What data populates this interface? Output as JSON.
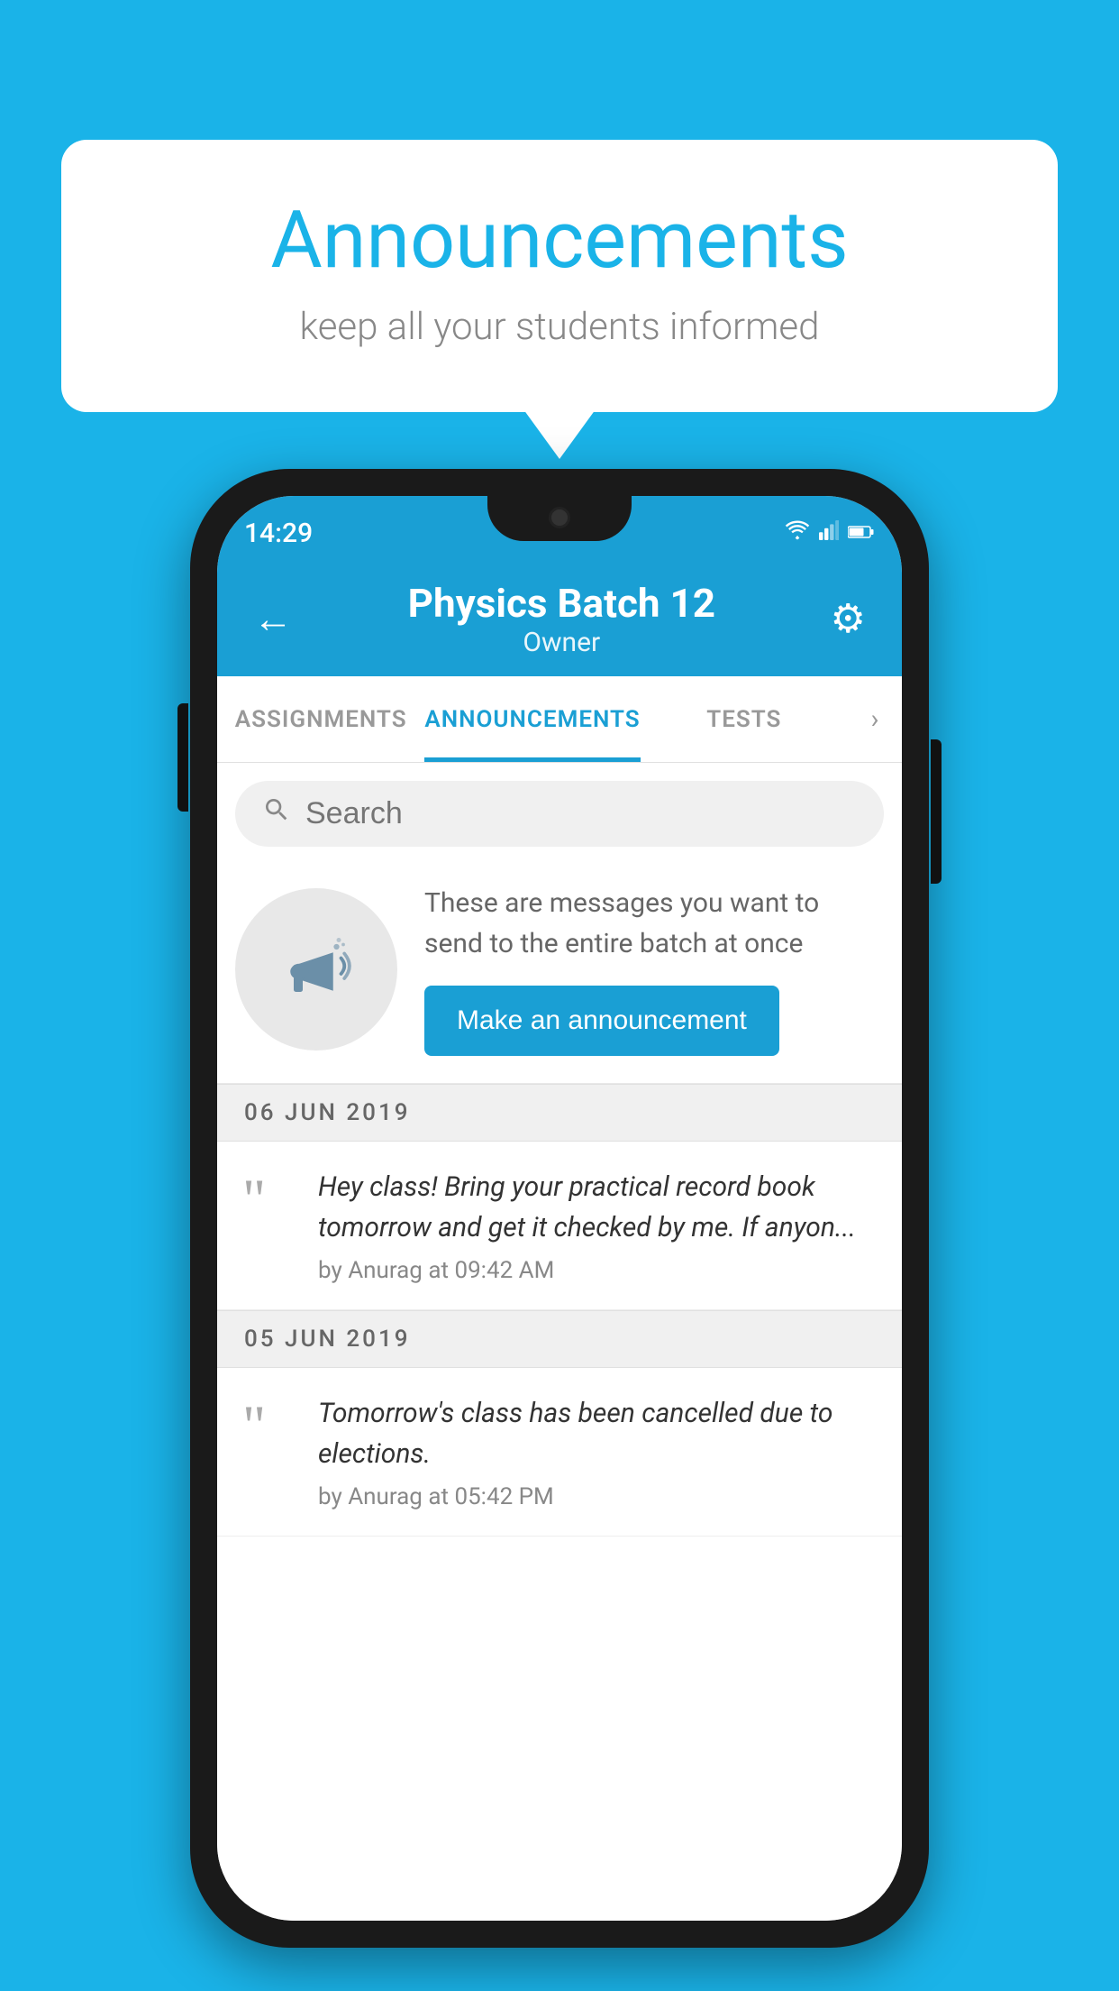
{
  "page": {
    "background_color": "#1ab3e8"
  },
  "speech_bubble": {
    "title": "Announcements",
    "subtitle": "keep all your students informed"
  },
  "status_bar": {
    "time": "14:29"
  },
  "app_bar": {
    "title": "Physics Batch 12",
    "subtitle": "Owner",
    "back_label": "←",
    "settings_label": "⚙"
  },
  "tabs": [
    {
      "label": "ASSIGNMENTS",
      "active": false
    },
    {
      "label": "ANNOUNCEMENTS",
      "active": true
    },
    {
      "label": "TESTS",
      "active": false
    }
  ],
  "search": {
    "placeholder": "Search"
  },
  "promo": {
    "description": "These are messages you want to send to the entire batch at once",
    "button_label": "Make an announcement"
  },
  "date_groups": [
    {
      "date": "06  JUN  2019",
      "announcements": [
        {
          "text": "Hey class! Bring your practical record book tomorrow and get it checked by me. If anyon...",
          "meta": "by Anurag at 09:42 AM"
        }
      ]
    },
    {
      "date": "05  JUN  2019",
      "announcements": [
        {
          "text": "Tomorrow's class has been cancelled due to elections.",
          "meta": "by Anurag at 05:42 PM"
        }
      ]
    }
  ]
}
